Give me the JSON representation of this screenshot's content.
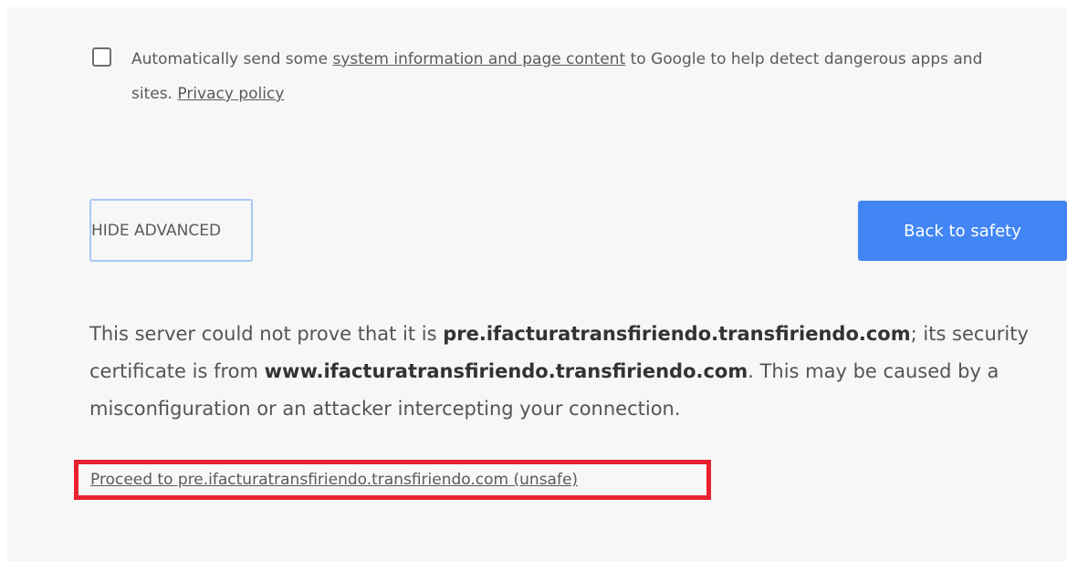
{
  "extended_reporting": {
    "text_before": "Automatically send some ",
    "link_system_info": "system information and page content",
    "text_middle": " to Google to help detect dangerous apps and sites. ",
    "link_privacy": "Privacy policy",
    "checked": false
  },
  "buttons": {
    "hide_advanced": "HIDE ADVANCED",
    "back_to_safety": "Back to safety"
  },
  "message": {
    "part1": "This server could not prove that it is ",
    "host1": "pre.ifacturatransfiriendo.transfiriendo.com",
    "part2": "; its security certificate is from ",
    "host2": "www.ifacturatransfiriendo.transfiriendo.com",
    "part3": ". This may be caused by a misconfiguration or an attacker intercepting your connection."
  },
  "proceed_link": "Proceed to pre.ifacturatransfiriendo.transfiriendo.com (unsafe)",
  "colors": {
    "primary_button": "#4285f4",
    "focus_ring": "#a9c8f5",
    "highlight_box": "#e8202f",
    "background": "#f7f7f7"
  }
}
